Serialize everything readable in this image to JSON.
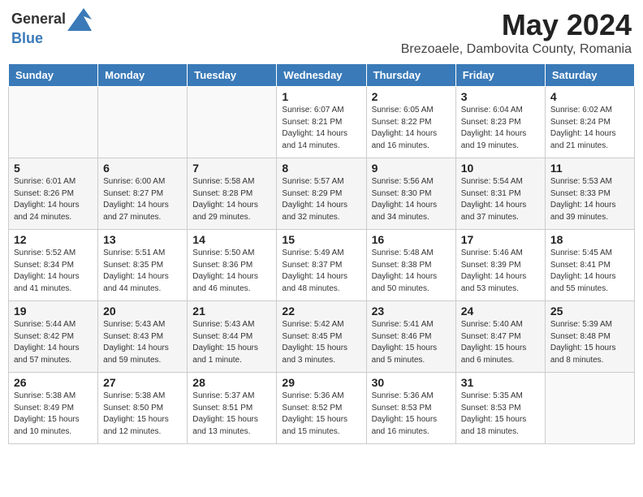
{
  "header": {
    "logo_general": "General",
    "logo_blue": "Blue",
    "month_year": "May 2024",
    "location": "Brezoaele, Dambovita County, Romania"
  },
  "days_of_week": [
    "Sunday",
    "Monday",
    "Tuesday",
    "Wednesday",
    "Thursday",
    "Friday",
    "Saturday"
  ],
  "weeks": [
    [
      {
        "day": "",
        "info": ""
      },
      {
        "day": "",
        "info": ""
      },
      {
        "day": "",
        "info": ""
      },
      {
        "day": "1",
        "info": "Sunrise: 6:07 AM\nSunset: 8:21 PM\nDaylight: 14 hours and 14 minutes."
      },
      {
        "day": "2",
        "info": "Sunrise: 6:05 AM\nSunset: 8:22 PM\nDaylight: 14 hours and 16 minutes."
      },
      {
        "day": "3",
        "info": "Sunrise: 6:04 AM\nSunset: 8:23 PM\nDaylight: 14 hours and 19 minutes."
      },
      {
        "day": "4",
        "info": "Sunrise: 6:02 AM\nSunset: 8:24 PM\nDaylight: 14 hours and 21 minutes."
      }
    ],
    [
      {
        "day": "5",
        "info": "Sunrise: 6:01 AM\nSunset: 8:26 PM\nDaylight: 14 hours and 24 minutes."
      },
      {
        "day": "6",
        "info": "Sunrise: 6:00 AM\nSunset: 8:27 PM\nDaylight: 14 hours and 27 minutes."
      },
      {
        "day": "7",
        "info": "Sunrise: 5:58 AM\nSunset: 8:28 PM\nDaylight: 14 hours and 29 minutes."
      },
      {
        "day": "8",
        "info": "Sunrise: 5:57 AM\nSunset: 8:29 PM\nDaylight: 14 hours and 32 minutes."
      },
      {
        "day": "9",
        "info": "Sunrise: 5:56 AM\nSunset: 8:30 PM\nDaylight: 14 hours and 34 minutes."
      },
      {
        "day": "10",
        "info": "Sunrise: 5:54 AM\nSunset: 8:31 PM\nDaylight: 14 hours and 37 minutes."
      },
      {
        "day": "11",
        "info": "Sunrise: 5:53 AM\nSunset: 8:33 PM\nDaylight: 14 hours and 39 minutes."
      }
    ],
    [
      {
        "day": "12",
        "info": "Sunrise: 5:52 AM\nSunset: 8:34 PM\nDaylight: 14 hours and 41 minutes."
      },
      {
        "day": "13",
        "info": "Sunrise: 5:51 AM\nSunset: 8:35 PM\nDaylight: 14 hours and 44 minutes."
      },
      {
        "day": "14",
        "info": "Sunrise: 5:50 AM\nSunset: 8:36 PM\nDaylight: 14 hours and 46 minutes."
      },
      {
        "day": "15",
        "info": "Sunrise: 5:49 AM\nSunset: 8:37 PM\nDaylight: 14 hours and 48 minutes."
      },
      {
        "day": "16",
        "info": "Sunrise: 5:48 AM\nSunset: 8:38 PM\nDaylight: 14 hours and 50 minutes."
      },
      {
        "day": "17",
        "info": "Sunrise: 5:46 AM\nSunset: 8:39 PM\nDaylight: 14 hours and 53 minutes."
      },
      {
        "day": "18",
        "info": "Sunrise: 5:45 AM\nSunset: 8:41 PM\nDaylight: 14 hours and 55 minutes."
      }
    ],
    [
      {
        "day": "19",
        "info": "Sunrise: 5:44 AM\nSunset: 8:42 PM\nDaylight: 14 hours and 57 minutes."
      },
      {
        "day": "20",
        "info": "Sunrise: 5:43 AM\nSunset: 8:43 PM\nDaylight: 14 hours and 59 minutes."
      },
      {
        "day": "21",
        "info": "Sunrise: 5:43 AM\nSunset: 8:44 PM\nDaylight: 15 hours and 1 minute."
      },
      {
        "day": "22",
        "info": "Sunrise: 5:42 AM\nSunset: 8:45 PM\nDaylight: 15 hours and 3 minutes."
      },
      {
        "day": "23",
        "info": "Sunrise: 5:41 AM\nSunset: 8:46 PM\nDaylight: 15 hours and 5 minutes."
      },
      {
        "day": "24",
        "info": "Sunrise: 5:40 AM\nSunset: 8:47 PM\nDaylight: 15 hours and 6 minutes."
      },
      {
        "day": "25",
        "info": "Sunrise: 5:39 AM\nSunset: 8:48 PM\nDaylight: 15 hours and 8 minutes."
      }
    ],
    [
      {
        "day": "26",
        "info": "Sunrise: 5:38 AM\nSunset: 8:49 PM\nDaylight: 15 hours and 10 minutes."
      },
      {
        "day": "27",
        "info": "Sunrise: 5:38 AM\nSunset: 8:50 PM\nDaylight: 15 hours and 12 minutes."
      },
      {
        "day": "28",
        "info": "Sunrise: 5:37 AM\nSunset: 8:51 PM\nDaylight: 15 hours and 13 minutes."
      },
      {
        "day": "29",
        "info": "Sunrise: 5:36 AM\nSunset: 8:52 PM\nDaylight: 15 hours and 15 minutes."
      },
      {
        "day": "30",
        "info": "Sunrise: 5:36 AM\nSunset: 8:53 PM\nDaylight: 15 hours and 16 minutes."
      },
      {
        "day": "31",
        "info": "Sunrise: 5:35 AM\nSunset: 8:53 PM\nDaylight: 15 hours and 18 minutes."
      },
      {
        "day": "",
        "info": ""
      }
    ]
  ]
}
